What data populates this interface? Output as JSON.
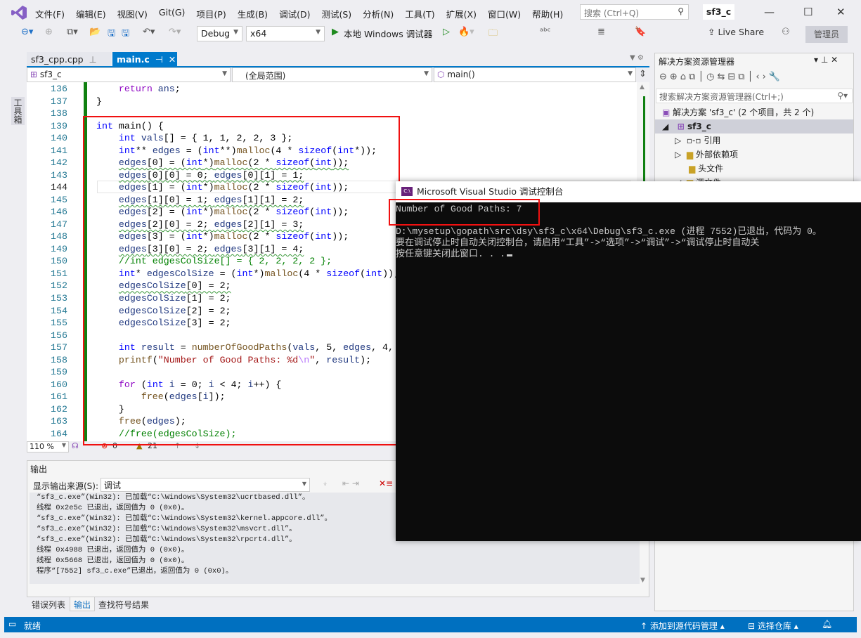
{
  "menubar": {
    "items": [
      "文件(F)",
      "编辑(E)",
      "视图(V)",
      "Git(G)",
      "项目(P)",
      "生成(B)",
      "调试(D)",
      "测试(S)",
      "分析(N)",
      "工具(T)",
      "扩展(X)",
      "窗口(W)",
      "帮助(H)"
    ],
    "search_placeholder": "搜索 (Ctrl+Q)",
    "solution_name": "sf3_c"
  },
  "toolbar": {
    "config": "Debug",
    "platform": "x64",
    "run_label": "本地 Windows 调试器",
    "live_share": "Live Share",
    "admin": "管理员"
  },
  "toolbox_label": "工具箱",
  "tabs": [
    {
      "label": "sf3_cpp.cpp",
      "active": false
    },
    {
      "label": "main.c",
      "active": true
    }
  ],
  "nav": {
    "project": "sf3_c",
    "scope": "(全局范围)",
    "member": "main()"
  },
  "editor": {
    "current_line": 144,
    "lines": [
      {
        "n": 136,
        "t": [
          [
            "p",
            "    "
          ],
          [
            "ctl",
            "return"
          ],
          [
            "var",
            " ans"
          ],
          [
            "p",
            ";"
          ]
        ]
      },
      {
        "n": 137,
        "t": [
          [
            "p",
            "}"
          ]
        ]
      },
      {
        "n": 138,
        "t": []
      },
      {
        "n": 139,
        "t": [
          [
            "kw",
            "int"
          ],
          [
            "p",
            " main() {"
          ]
        ]
      },
      {
        "n": 140,
        "t": [
          [
            "p",
            "    "
          ],
          [
            "kw",
            "int"
          ],
          [
            "var",
            " vals"
          ],
          [
            "p",
            "[] = { 1, 1, 2, 2, 3 };"
          ]
        ]
      },
      {
        "n": 141,
        "t": [
          [
            "p",
            "    "
          ],
          [
            "kw",
            "int"
          ],
          [
            "p",
            "** "
          ],
          [
            "var",
            "edges"
          ],
          [
            "p",
            " = ("
          ],
          [
            "kw",
            "int"
          ],
          [
            "p",
            "**)"
          ],
          [
            "fn",
            "malloc"
          ],
          [
            "p",
            "(4 * "
          ],
          [
            "kw",
            "sizeof"
          ],
          [
            "p",
            "("
          ],
          [
            "kw",
            "int"
          ],
          [
            "p",
            "*));"
          ]
        ]
      },
      {
        "n": 142,
        "sq": true,
        "t": [
          [
            "p",
            "    "
          ],
          [
            "var",
            "edges"
          ],
          [
            "p",
            "[0] = ("
          ],
          [
            "kw",
            "int"
          ],
          [
            "p",
            "*)"
          ],
          [
            "fn",
            "malloc"
          ],
          [
            "p",
            "(2 * "
          ],
          [
            "kw",
            "sizeof"
          ],
          [
            "p",
            "("
          ],
          [
            "kw",
            "int"
          ],
          [
            "p",
            "));"
          ]
        ]
      },
      {
        "n": 143,
        "sq": true,
        "t": [
          [
            "p",
            "    "
          ],
          [
            "var",
            "edges"
          ],
          [
            "p",
            "[0][0] = 0; "
          ],
          [
            "var",
            "edges"
          ],
          [
            "p",
            "[0][1] = 1;"
          ]
        ]
      },
      {
        "n": 144,
        "t": [
          [
            "p",
            "    "
          ],
          [
            "var",
            "edges"
          ],
          [
            "p",
            "[1] = ("
          ],
          [
            "kw",
            "int"
          ],
          [
            "p",
            "*)"
          ],
          [
            "fn",
            "malloc"
          ],
          [
            "p",
            "(2 * "
          ],
          [
            "kw",
            "sizeof"
          ],
          [
            "p",
            "("
          ],
          [
            "kw",
            "int"
          ],
          [
            "p",
            "));"
          ]
        ]
      },
      {
        "n": 145,
        "sq": true,
        "t": [
          [
            "p",
            "    "
          ],
          [
            "var",
            "edges"
          ],
          [
            "p",
            "[1][0] = 1; "
          ],
          [
            "var",
            "edges"
          ],
          [
            "p",
            "[1][1] = 2;"
          ]
        ]
      },
      {
        "n": 146,
        "t": [
          [
            "p",
            "    "
          ],
          [
            "var",
            "edges"
          ],
          [
            "p",
            "[2] = ("
          ],
          [
            "kw",
            "int"
          ],
          [
            "p",
            "*)"
          ],
          [
            "fn",
            "malloc"
          ],
          [
            "p",
            "(2 * "
          ],
          [
            "kw",
            "sizeof"
          ],
          [
            "p",
            "("
          ],
          [
            "kw",
            "int"
          ],
          [
            "p",
            "));"
          ]
        ]
      },
      {
        "n": 147,
        "sq": true,
        "t": [
          [
            "p",
            "    "
          ],
          [
            "var",
            "edges"
          ],
          [
            "p",
            "[2][0] = 2; "
          ],
          [
            "var",
            "edges"
          ],
          [
            "p",
            "[2][1] = 3;"
          ]
        ]
      },
      {
        "n": 148,
        "t": [
          [
            "p",
            "    "
          ],
          [
            "var",
            "edges"
          ],
          [
            "p",
            "[3] = ("
          ],
          [
            "kw",
            "int"
          ],
          [
            "p",
            "*)"
          ],
          [
            "fn",
            "malloc"
          ],
          [
            "p",
            "(2 * "
          ],
          [
            "kw",
            "sizeof"
          ],
          [
            "p",
            "("
          ],
          [
            "kw",
            "int"
          ],
          [
            "p",
            "));"
          ]
        ]
      },
      {
        "n": 149,
        "sq": true,
        "t": [
          [
            "p",
            "    "
          ],
          [
            "var",
            "edges"
          ],
          [
            "p",
            "[3][0] = 2; "
          ],
          [
            "var",
            "edges"
          ],
          [
            "p",
            "[3][1] = 4;"
          ]
        ]
      },
      {
        "n": 150,
        "t": [
          [
            "p",
            "    "
          ],
          [
            "cm",
            "//int edgesColSize[] = { 2, 2, 2, 2 };"
          ]
        ]
      },
      {
        "n": 151,
        "t": [
          [
            "p",
            "    "
          ],
          [
            "kw",
            "int"
          ],
          [
            "p",
            "* "
          ],
          [
            "var",
            "edgesColSize"
          ],
          [
            "p",
            " = ("
          ],
          [
            "kw",
            "int"
          ],
          [
            "p",
            "*)"
          ],
          [
            "fn",
            "malloc"
          ],
          [
            "p",
            "(4 * "
          ],
          [
            "kw",
            "sizeof"
          ],
          [
            "p",
            "("
          ],
          [
            "kw",
            "int"
          ],
          [
            "p",
            "));"
          ]
        ]
      },
      {
        "n": 152,
        "sq": true,
        "t": [
          [
            "p",
            "    "
          ],
          [
            "var",
            "edgesColSize"
          ],
          [
            "p",
            "[0] = 2;"
          ]
        ]
      },
      {
        "n": 153,
        "t": [
          [
            "p",
            "    "
          ],
          [
            "var",
            "edgesColSize"
          ],
          [
            "p",
            "[1] = 2;"
          ]
        ]
      },
      {
        "n": 154,
        "t": [
          [
            "p",
            "    "
          ],
          [
            "var",
            "edgesColSize"
          ],
          [
            "p",
            "[2] = 2;"
          ]
        ]
      },
      {
        "n": 155,
        "t": [
          [
            "p",
            "    "
          ],
          [
            "var",
            "edgesColSize"
          ],
          [
            "p",
            "[3] = 2;"
          ]
        ]
      },
      {
        "n": 156,
        "t": []
      },
      {
        "n": 157,
        "t": [
          [
            "p",
            "    "
          ],
          [
            "kw",
            "int"
          ],
          [
            "var",
            " result"
          ],
          [
            "p",
            " = "
          ],
          [
            "fn",
            "numberOfGoodPaths"
          ],
          [
            "p",
            "("
          ],
          [
            "var",
            "vals"
          ],
          [
            "p",
            ", 5, "
          ],
          [
            "var",
            "edges"
          ],
          [
            "p",
            ", 4, "
          ],
          [
            "var",
            "edgesC"
          ]
        ]
      },
      {
        "n": 158,
        "t": [
          [
            "p",
            "    "
          ],
          [
            "fn",
            "printf"
          ],
          [
            "p",
            "("
          ],
          [
            "str",
            "\"Number of Good Paths: %d"
          ],
          [
            "esc",
            "\\n"
          ],
          [
            "str",
            "\""
          ],
          [
            "p",
            ", "
          ],
          [
            "var",
            "result"
          ],
          [
            "p",
            ");"
          ]
        ]
      },
      {
        "n": 159,
        "t": []
      },
      {
        "n": 160,
        "t": [
          [
            "p",
            "    "
          ],
          [
            "ctl",
            "for"
          ],
          [
            "p",
            " ("
          ],
          [
            "kw",
            "int"
          ],
          [
            "var",
            " i"
          ],
          [
            "p",
            " = 0; "
          ],
          [
            "var",
            "i"
          ],
          [
            "p",
            " < 4; "
          ],
          [
            "var",
            "i"
          ],
          [
            "p",
            "++) {"
          ]
        ]
      },
      {
        "n": 161,
        "t": [
          [
            "p",
            "        "
          ],
          [
            "fn",
            "free"
          ],
          [
            "p",
            "("
          ],
          [
            "var",
            "edges"
          ],
          [
            "p",
            "["
          ],
          [
            "var",
            "i"
          ],
          [
            "p",
            "]);"
          ]
        ]
      },
      {
        "n": 162,
        "t": [
          [
            "p",
            "    }"
          ]
        ]
      },
      {
        "n": 163,
        "t": [
          [
            "p",
            "    "
          ],
          [
            "fn",
            "free"
          ],
          [
            "p",
            "("
          ],
          [
            "var",
            "edges"
          ],
          [
            "p",
            ");"
          ]
        ]
      },
      {
        "n": 164,
        "t": [
          [
            "p",
            "    "
          ],
          [
            "cm",
            "//free(edgesColSize);"
          ]
        ]
      }
    ],
    "zoom": "110 %",
    "errors": "0",
    "warnings": "21"
  },
  "output": {
    "title": "输出",
    "source_label": "显示输出来源(S):",
    "source_value": "调试",
    "lines": [
      "“sf3_c.exe”(Win32): 已加载“C:\\Windows\\System32\\ucrtbased.dll”。",
      "线程 0x2e5c 已退出，返回值为 0 (0x0)。",
      "“sf3_c.exe”(Win32): 已加载“C:\\Windows\\System32\\kernel.appcore.dll”。",
      "“sf3_c.exe”(Win32): 已加载“C:\\Windows\\System32\\msvcrt.dll”。",
      "“sf3_c.exe”(Win32): 已加载“C:\\Windows\\System32\\rpcrt4.dll”。",
      "线程 0x4988 已退出，返回值为 0 (0x0)。",
      "线程 0x5668 已退出，返回值为 0 (0x0)。",
      "程序“[7552] sf3_c.exe”已退出，返回值为 0 (0x0)。"
    ]
  },
  "bottom_tabs": [
    "错误列表",
    "输出",
    "查找符号结果"
  ],
  "statusbar": {
    "ready": "就绪",
    "add_source": "添加到源代码管理",
    "select_repo": "选择仓库"
  },
  "solution_explorer": {
    "title": "解决方案资源管理器",
    "search_placeholder": "搜索解决方案资源管理器(Ctrl+;)",
    "items": [
      "解决方案 'sf3_c' (2 个项目，共 2 个)",
      "sf3_c",
      "引用",
      "外部依赖项",
      "头文件",
      "源文件"
    ]
  },
  "console": {
    "title": "Microsoft Visual Studio 调试控制台",
    "lines": [
      "Number of Good Paths: 7",
      "",
      "D:\\mysetup\\gopath\\src\\dsy\\sf3_c\\x64\\Debug\\sf3_c.exe (进程 7552)已退出，代码为 0。",
      "要在调试停止时自动关闭控制台，请启用“工具”->“选项”->“调试”->“调试停止时自动关",
      "按任意键关闭此窗口. . ."
    ]
  }
}
